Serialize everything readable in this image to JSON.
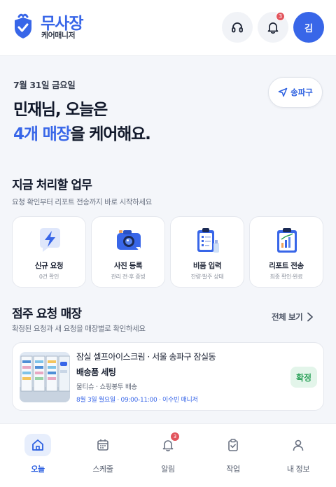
{
  "header": {
    "brand_name": "무사장",
    "brand_sub": "케어매니저",
    "notification_count": "3",
    "avatar_initial": "김"
  },
  "greeting": {
    "date": "7월 31일 금요일",
    "line1": "민재님, 오늘은",
    "line2_highlight": "4개 매장",
    "line2_rest": "을 케어해요."
  },
  "region_button": {
    "label": "송파구"
  },
  "tasks": {
    "title": "지금 처리할 업무",
    "subtitle": "요청 확인부터 리포트 전송까지 바로 시작하세요",
    "items": [
      {
        "label": "신규 요청",
        "desc": "0건 확인",
        "icon": "lightning-icon"
      },
      {
        "label": "사진 등록",
        "desc": "관리 전·후 증빙",
        "icon": "camera-icon"
      },
      {
        "label": "비품 입력",
        "desc": "잔량·발주 상태",
        "icon": "clipboard-supplies-icon"
      },
      {
        "label": "리포트 전송",
        "desc": "최종 확인·완료",
        "icon": "report-clipboard-icon"
      }
    ]
  },
  "requests": {
    "title": "점주 요청 매장",
    "subtitle": "확정된 요청과 새 요청을 매장별로 확인하세요",
    "view_all": "전체 보기",
    "card": {
      "store_name": "잠실 셀프아이스크림 · 서울 송파구 잠실동",
      "task": "배송품 세팅",
      "items": "물티슈 · 쇼핑봉투 배송",
      "schedule": "8월 3일 월요일 · 09:00-11:00 · 이수빈 매니저",
      "status": "확정"
    }
  },
  "nav": {
    "items": [
      {
        "label": "오늘",
        "icon": "home-icon"
      },
      {
        "label": "스케줄",
        "icon": "calendar-icon"
      },
      {
        "label": "알림",
        "icon": "bell-icon"
      },
      {
        "label": "작업",
        "icon": "task-clipboard-icon"
      },
      {
        "label": "내 정보",
        "icon": "person-icon"
      }
    ],
    "alert_badge": "3"
  },
  "colors": {
    "primary": "#3866e8",
    "success": "#2fa35c",
    "danger": "#e2545c"
  }
}
